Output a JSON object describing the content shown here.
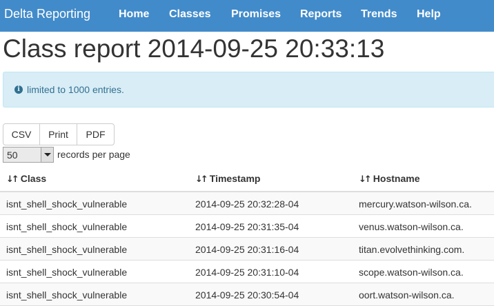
{
  "navbar": {
    "brand": "Delta Reporting",
    "links": [
      "Home",
      "Classes",
      "Promises",
      "Reports",
      "Trends",
      "Help"
    ],
    "color": "#428bca"
  },
  "page": {
    "title": "Class report 2014-09-25 20:33:13"
  },
  "alert": {
    "icon": "info-circle-icon",
    "text": "limited to 1000 entries."
  },
  "export_buttons": [
    "CSV",
    "Print",
    "PDF"
  ],
  "pagination": {
    "page_size": "50",
    "label": "records per page"
  },
  "table": {
    "columns": [
      "Class",
      "Timestamp",
      "Hostname"
    ],
    "rows": [
      [
        "isnt_shell_shock_vulnerable",
        "2014-09-25 20:32:28-04",
        "mercury.watson-wilson.ca."
      ],
      [
        "isnt_shell_shock_vulnerable",
        "2014-09-25 20:31:35-04",
        "venus.watson-wilson.ca."
      ],
      [
        "isnt_shell_shock_vulnerable",
        "2014-09-25 20:31:16-04",
        "titan.evolvethinking.com."
      ],
      [
        "isnt_shell_shock_vulnerable",
        "2014-09-25 20:31:10-04",
        "scope.watson-wilson.ca."
      ],
      [
        "isnt_shell_shock_vulnerable",
        "2014-09-25 20:30:54-04",
        "oort.watson-wilson.ca."
      ]
    ]
  }
}
